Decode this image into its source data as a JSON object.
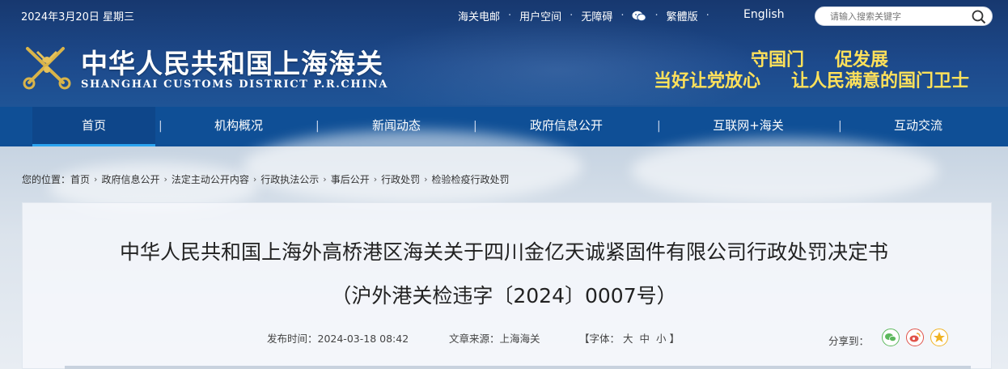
{
  "topbar": {
    "date": "2024年3月20日 星期三",
    "links": [
      "海关电邮",
      "用户空间",
      "无障碍"
    ],
    "traditional": "繁體版",
    "english": "English",
    "search_placeholder": "请输入搜索关键字"
  },
  "site": {
    "title": "中华人民共和国上海海关",
    "subtitle": "SHANGHAI CUSTOMS DISTRICT P.R.CHINA",
    "slogan_line1": [
      "守国门",
      "促发展"
    ],
    "slogan_line2": [
      "当好让党放心",
      "让人民满意的国门卫士"
    ]
  },
  "nav": {
    "items": [
      "首页",
      "机构概况",
      "新闻动态",
      "政府信息公开",
      "互联网+海关",
      "互动交流"
    ],
    "active": "首页",
    "separator": "|"
  },
  "breadcrumb": {
    "prefix": "您的位置：",
    "items": [
      "首页",
      "政府信息公开",
      "法定主动公开内容",
      "行政执法公示",
      "事后公开",
      "行政处罚",
      "检验检疫行政处罚"
    ]
  },
  "article": {
    "title_line1": "中华人民共和国上海外高桥港区海关关于四川金亿天诚紧固件有限公司行政处罚决定书",
    "title_line2": "（沪外港关检违字〔2024〕0007号）",
    "publish_time": "发布时间：2024-03-18 08:42",
    "source": "文章来源：上海海关",
    "font_label": "【字体：",
    "font_sizes": [
      "大",
      "中",
      "小"
    ],
    "font_close": "】",
    "share_label": "分享到："
  },
  "colors": {
    "header_bg": "#1d4a8c",
    "nav_bg": "#0f4f96",
    "slogan": "#ffe15a",
    "active_underline": "#2aa3f0"
  },
  "icons": {
    "search": "search-icon",
    "wechat": "wechat-icon",
    "logo": "customs-emblem-icon",
    "share": [
      "wechat-share-icon",
      "weibo-share-icon",
      "qzone-share-icon"
    ]
  }
}
